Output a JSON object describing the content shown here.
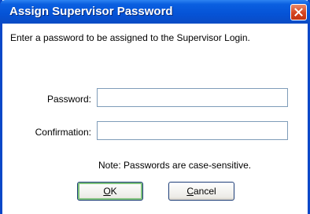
{
  "window": {
    "title": "Assign Supervisor Password"
  },
  "dialog": {
    "prompt": "Enter a password to be assigned to the Supervisor Login.",
    "password_label": "Password:",
    "password_value": "",
    "confirmation_label": "Confirmation:",
    "confirmation_value": "",
    "note": "Note: Passwords are case-sensitive."
  },
  "buttons": {
    "ok_mnemonic": "O",
    "ok_rest": "K",
    "cancel_mnemonic": "C",
    "cancel_rest": "ancel"
  },
  "icons": {
    "close": "close-icon"
  },
  "colors": {
    "titlebar": "#0553d6",
    "close_button": "#d5441f",
    "default_button_focus": "#7ec27b"
  }
}
